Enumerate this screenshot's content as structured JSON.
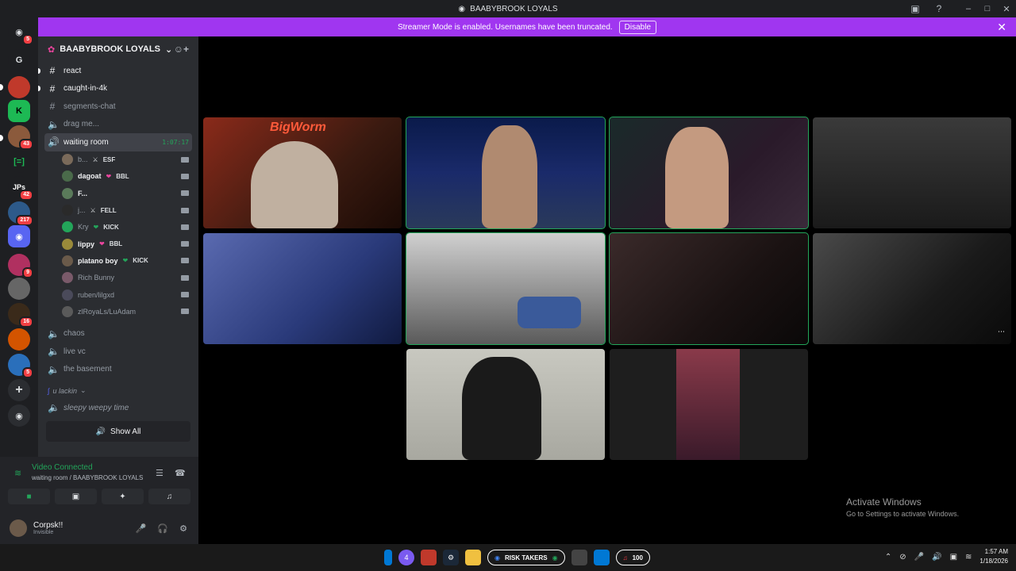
{
  "window": {
    "title": "BAABYBROOK LOYALS"
  },
  "banner": {
    "text": "Streamer Mode is enabled. Usernames have been truncated.",
    "disable_label": "Disable"
  },
  "servers": [
    {
      "label": "G",
      "badge": ""
    },
    {
      "label": "K",
      "badge": ""
    },
    {
      "label": "43",
      "badge": "43"
    },
    {
      "label": "[=]",
      "badge": ""
    },
    {
      "label": "JPs",
      "badge": "42"
    },
    {
      "label": "217",
      "badge": "217"
    },
    {
      "label": "9",
      "badge": "9"
    },
    {
      "label": "16",
      "badge": "16"
    },
    {
      "label": "5",
      "badge": "5"
    }
  ],
  "home_badge": "5",
  "guild": {
    "name": "BAABYBROOK LOYALS"
  },
  "channels": [
    {
      "name": "react",
      "type": "text",
      "unread": true
    },
    {
      "name": "caught-in-4k",
      "type": "text",
      "unread": true
    },
    {
      "name": "segments-chat",
      "type": "text",
      "unread": false
    },
    {
      "name": "drag me...",
      "type": "voice",
      "unread": false
    }
  ],
  "active_voice": {
    "name": "waiting room",
    "timer": "1:07:17"
  },
  "members": [
    {
      "name": "b...",
      "tag": "ESF",
      "tag_icon": "sword",
      "bold": false
    },
    {
      "name": "dagoat",
      "tag": "BBL",
      "tag_icon": "heart",
      "bold": true
    },
    {
      "name": "F...",
      "tag": "",
      "tag_icon": "",
      "bold": true
    },
    {
      "name": "j...",
      "tag": "FELL",
      "tag_icon": "sword",
      "bold": false
    },
    {
      "name": "Kry",
      "tag": "KICK",
      "tag_icon": "heart",
      "bold": false
    },
    {
      "name": "lippy",
      "tag": "BBL",
      "tag_icon": "heart",
      "bold": true
    },
    {
      "name": "platano boy",
      "tag": "KICK",
      "tag_icon": "heart",
      "bold": true
    },
    {
      "name": "Rich Bunny",
      "tag": "",
      "tag_icon": "",
      "bold": false
    },
    {
      "name": "ruben/lilgxd",
      "tag": "",
      "tag_icon": "",
      "bold": false
    },
    {
      "name": "zlRoyaLs/LuAdam",
      "tag": "",
      "tag_icon": "",
      "bold": false
    }
  ],
  "more_channels": [
    {
      "name": "chaos"
    },
    {
      "name": "live vc"
    },
    {
      "name": "the basement"
    }
  ],
  "category": {
    "name": "u lackin"
  },
  "sleepy": {
    "name": "sleepy weepy time"
  },
  "show_all_label": "Show All",
  "voice": {
    "status": "Video Connected",
    "location": "waiting room / BAABYBROOK LOYALS"
  },
  "user": {
    "name": "Corpsk!!",
    "status": "Invisible"
  },
  "stage": {
    "tile_overlay_text": "BigWorm"
  },
  "watermark": {
    "line1": "Activate Windows",
    "line2": "Go to Settings to activate Windows."
  },
  "taskbar": {
    "pill_label": "RISK TAKERS",
    "music_count": "100",
    "badge_count": "4"
  },
  "clock": {
    "time": "1:57 AM",
    "date": "1/18/2026"
  },
  "colors": {
    "accent_green": "#23a55a",
    "banner_purple": "#a036f0",
    "discord_blurple": "#5865f2"
  }
}
